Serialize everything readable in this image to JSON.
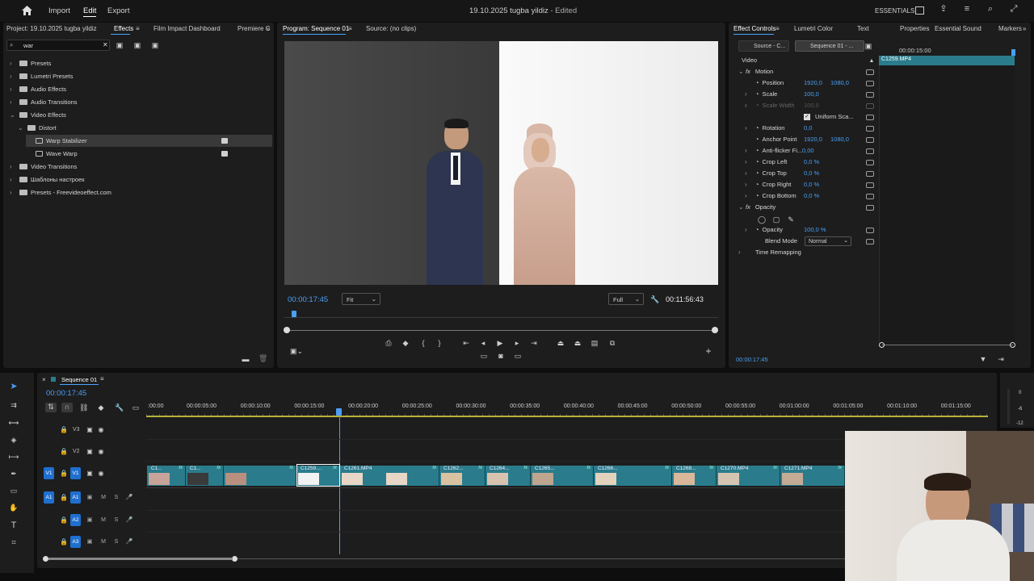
{
  "app": {
    "menu": [
      "Import",
      "Edit",
      "Export"
    ],
    "active_menu": "Edit",
    "title": "19.10.2025 tugba yildiz",
    "status": "- Edited",
    "workspace": "ESSENTIALS"
  },
  "left_panel": {
    "tabs": [
      "Project: 19.10.2025 tugba yildiz",
      "Effects",
      "Film Impact Dashboard",
      "Premiere C"
    ],
    "active_tab": "Effects",
    "search_value": "war",
    "tree": [
      {
        "label": "Presets",
        "expanded": false,
        "level": 0,
        "kind": "folder"
      },
      {
        "label": "Lumetri Presets",
        "expanded": false,
        "level": 0,
        "kind": "folder"
      },
      {
        "label": "Audio Effects",
        "expanded": false,
        "level": 0,
        "kind": "folder"
      },
      {
        "label": "Audio Transitions",
        "expanded": false,
        "level": 0,
        "kind": "folder"
      },
      {
        "label": "Video Effects",
        "expanded": true,
        "level": 0,
        "kind": "folder"
      },
      {
        "label": "Distort",
        "expanded": true,
        "level": 1,
        "kind": "folder"
      },
      {
        "label": "Warp Stabilizer",
        "expanded": false,
        "level": 2,
        "kind": "effect",
        "selected": true
      },
      {
        "label": "Wave Warp",
        "expanded": false,
        "level": 2,
        "kind": "effect"
      },
      {
        "label": "Video Transitions",
        "expanded": false,
        "level": 0,
        "kind": "folder"
      },
      {
        "label": "Шаблоны настроек",
        "expanded": false,
        "level": 0,
        "kind": "folder"
      },
      {
        "label": "Presets - Freevideoeffect.com",
        "expanded": false,
        "level": 0,
        "kind": "folder"
      }
    ]
  },
  "program_monitor": {
    "tabs": [
      "Program: Sequence 01",
      "Source: (no clips)"
    ],
    "timecode": "00:00:17:45",
    "fit": "Fit",
    "quality": "Full",
    "duration": "00:11:56:43"
  },
  "effect_controls": {
    "tabs": [
      "Effect Controls",
      "Lumetri Color",
      "Text",
      "Properties",
      "Essential Sound",
      "Markers"
    ],
    "source_btn": "Source - C...",
    "sequence_btn": "Sequence 01 - ...",
    "mini_timecode": "00:00:15:00",
    "clip_name": "C1259.MP4",
    "section": "Video",
    "motion": "Motion",
    "rows": [
      {
        "label": "Position",
        "v1": "1920,0",
        "v2": "1080,0"
      },
      {
        "label": "Scale",
        "v1": "100,0",
        "v2": ""
      },
      {
        "label": "Scale Width",
        "v1": "100,0",
        "v2": ""
      },
      {
        "label": "Uniform Sca...",
        "v1": "",
        "v2": ""
      },
      {
        "label": "Rotation",
        "v1": "0,0",
        "v2": ""
      },
      {
        "label": "Anchor Point",
        "v1": "1920,0",
        "v2": "1080,0"
      },
      {
        "label": "Anti-flicker Fi...",
        "v1": "0,00",
        "v2": ""
      },
      {
        "label": "Crop Left",
        "v1": "0,0 %",
        "v2": ""
      },
      {
        "label": "Crop Top",
        "v1": "0,0 %",
        "v2": ""
      },
      {
        "label": "Crop Right",
        "v1": "0,0 %",
        "v2": ""
      },
      {
        "label": "Crop Bottom",
        "v1": "0,0 %",
        "v2": ""
      }
    ],
    "opacity_section": "Opacity",
    "opacity_label": "Opacity",
    "opacity_value": "100,0 %",
    "blend_label": "Blend Mode",
    "blend_value": "Normal",
    "time_remap": "Time Remapping",
    "bottom_timecode": "00:00:17:45"
  },
  "timeline": {
    "sequence_name": "Sequence 01",
    "timecode": "00:00:17:45",
    "ruler": [
      ":00:00",
      "00:00:05:00",
      "00:00:10:00",
      "00:00:15:00",
      "00:00:20:00",
      "00:00:25:00",
      "00:00:30:00",
      "00:00:35:00",
      "00:00:40:00",
      "00:00:45:00",
      "00:00:50:00",
      "00:00:55:00",
      "00:01:00:00",
      "00:01:05:00",
      "00:01:10:00",
      "00:01:15:00"
    ],
    "video_tracks": [
      "V3",
      "V2",
      "V1"
    ],
    "audio_tracks": [
      "A1",
      "A2",
      "A3"
    ],
    "clips": [
      "C1...",
      "C1...",
      "C1259....",
      "C1261.MP4",
      "C1262...",
      "C1264...",
      "C1265...",
      "C1266...",
      "C1268...",
      "C1270.MP4",
      "C1271.MP4"
    ]
  },
  "meter_labels": [
    "0",
    "-6",
    "-12"
  ],
  "colors": {
    "accent": "#4a9ff5",
    "clip": "#2a7c8c",
    "track_badge": "#1f6fcf"
  }
}
